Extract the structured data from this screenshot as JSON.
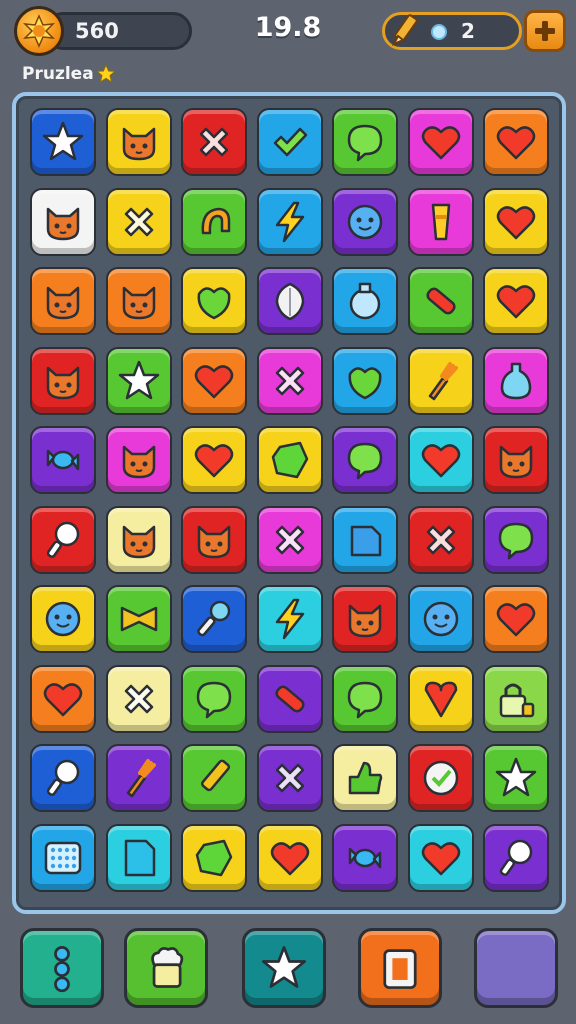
{
  "header": {
    "score": "560",
    "timer": "19.8",
    "gems": "2",
    "subtitle": "Pruzlea",
    "coin_icon": "sun-coin-icon",
    "pencil_icon": "pencil-icon",
    "add_icon": "plus-icon"
  },
  "colors": {
    "blue": "#1f5fd6",
    "yellow": "#f6d31a",
    "red": "#e02424",
    "sky": "#22a6e8",
    "green": "#58c832",
    "pink": "#e83ad8",
    "orange": "#f57f1e",
    "white": "#f4f4f4",
    "lgreen": "#8ad84a",
    "purple": "#7a2fd0",
    "cyan": "#2ccfe0",
    "lyellow": "#f5eda0"
  },
  "board": {
    "rows": [
      [
        {
          "color": "blue",
          "icon": "star"
        },
        {
          "color": "yellow",
          "icon": "cat"
        },
        {
          "color": "red",
          "icon": "cross"
        },
        {
          "color": "sky",
          "icon": "check"
        },
        {
          "color": "green",
          "icon": "bubble"
        },
        {
          "color": "pink",
          "icon": "heart"
        },
        {
          "color": "orange",
          "icon": "heart"
        }
      ],
      [
        {
          "color": "white",
          "icon": "cat"
        },
        {
          "color": "yellow",
          "icon": "cross"
        },
        {
          "color": "green",
          "icon": "hook"
        },
        {
          "color": "sky",
          "icon": "bolt"
        },
        {
          "color": "purple",
          "icon": "face"
        },
        {
          "color": "pink",
          "icon": "glass"
        },
        {
          "color": "yellow",
          "icon": "heart"
        }
      ],
      [
        {
          "color": "orange",
          "icon": "cat"
        },
        {
          "color": "orange",
          "icon": "cat"
        },
        {
          "color": "yellow",
          "icon": "leaf"
        },
        {
          "color": "purple",
          "icon": "shield"
        },
        {
          "color": "sky",
          "icon": "jar"
        },
        {
          "color": "green",
          "icon": "bar"
        },
        {
          "color": "yellow",
          "icon": "heart"
        }
      ],
      [
        {
          "color": "red",
          "icon": "cat"
        },
        {
          "color": "green",
          "icon": "star"
        },
        {
          "color": "orange",
          "icon": "heart"
        },
        {
          "color": "pink",
          "icon": "cross"
        },
        {
          "color": "sky",
          "icon": "leaf"
        },
        {
          "color": "yellow",
          "icon": "fork"
        },
        {
          "color": "pink",
          "icon": "bottle"
        }
      ],
      [
        {
          "color": "purple",
          "icon": "candy"
        },
        {
          "color": "pink",
          "icon": "cat"
        },
        {
          "color": "yellow",
          "icon": "heart"
        },
        {
          "color": "yellow",
          "icon": "gem"
        },
        {
          "color": "purple",
          "icon": "bubble"
        },
        {
          "color": "cyan",
          "icon": "heart"
        },
        {
          "color": "red",
          "icon": "cat"
        }
      ],
      [
        {
          "color": "red",
          "icon": "pin"
        },
        {
          "color": "lyellow",
          "icon": "cat"
        },
        {
          "color": "red",
          "icon": "cat"
        },
        {
          "color": "pink",
          "icon": "cross"
        },
        {
          "color": "sky",
          "icon": "square"
        },
        {
          "color": "red",
          "icon": "cross"
        },
        {
          "color": "purple",
          "icon": "bubble"
        }
      ],
      [
        {
          "color": "yellow",
          "icon": "face"
        },
        {
          "color": "green",
          "icon": "bow"
        },
        {
          "color": "blue",
          "icon": "wand"
        },
        {
          "color": "cyan",
          "icon": "bolt"
        },
        {
          "color": "red",
          "icon": "cat"
        },
        {
          "color": "sky",
          "icon": "face"
        },
        {
          "color": "orange",
          "icon": "heart"
        }
      ],
      [
        {
          "color": "orange",
          "icon": "heart"
        },
        {
          "color": "lyellow",
          "icon": "cross"
        },
        {
          "color": "green",
          "icon": "bubble"
        },
        {
          "color": "purple",
          "icon": "bar"
        },
        {
          "color": "green",
          "icon": "bubble"
        },
        {
          "color": "yellow",
          "icon": "cone"
        },
        {
          "color": "lgreen",
          "icon": "lock"
        }
      ],
      [
        {
          "color": "blue",
          "icon": "pin"
        },
        {
          "color": "purple",
          "icon": "fork"
        },
        {
          "color": "green",
          "icon": "pencil"
        },
        {
          "color": "purple",
          "icon": "cross"
        },
        {
          "color": "lyellow",
          "icon": "thumb"
        },
        {
          "color": "red",
          "icon": "clock"
        },
        {
          "color": "green",
          "icon": "star"
        }
      ],
      [
        {
          "color": "sky",
          "icon": "grid"
        },
        {
          "color": "cyan",
          "icon": "page"
        },
        {
          "color": "yellow",
          "icon": "gem"
        },
        {
          "color": "yellow",
          "icon": "heart"
        },
        {
          "color": "purple",
          "icon": "candy"
        },
        {
          "color": "cyan",
          "icon": "heart"
        },
        {
          "color": "purple",
          "icon": "pin"
        }
      ]
    ]
  },
  "toolbar": [
    {
      "name": "hint-button",
      "color": "#23b08e",
      "icon": "dots"
    },
    {
      "name": "chef-button",
      "color": "#56c030",
      "icon": "chef"
    },
    {
      "name": "shuffle-button",
      "color": "#138a8e",
      "icon": "star"
    },
    {
      "name": "frame-button",
      "color": "#f2701c",
      "icon": "frame"
    },
    {
      "name": "empty-button",
      "color": "#7a6cc4",
      "icon": "none"
    }
  ]
}
